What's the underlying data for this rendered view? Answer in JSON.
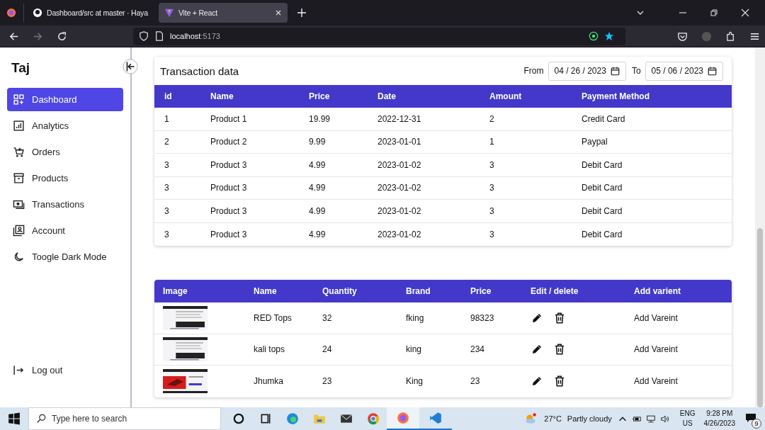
{
  "browser": {
    "tabs": [
      {
        "title": "Dashboard/src at master · Haya",
        "selected": false
      },
      {
        "title": "Vite + React",
        "selected": true
      }
    ],
    "address": {
      "host": "localhost",
      "port": ":5173"
    }
  },
  "sidebar": {
    "brand": "Taj",
    "items": [
      {
        "label": "Dashboard",
        "selected": true
      },
      {
        "label": "Analytics",
        "selected": false
      },
      {
        "label": "Orders",
        "selected": false
      },
      {
        "label": "Products",
        "selected": false
      },
      {
        "label": "Transactions",
        "selected": false
      },
      {
        "label": "Account",
        "selected": false
      },
      {
        "label": "Toogle Dark Mode",
        "selected": false
      }
    ],
    "logout": "Log out"
  },
  "transactions": {
    "title": "Transaction data",
    "from_label": "From",
    "from": "04 / 26 / 2023",
    "to_label": "To",
    "to": "05 / 06 / 2023",
    "columns": [
      "id",
      "Name",
      "Price",
      "Date",
      "Amount",
      "Payment Method"
    ],
    "rows": [
      [
        "1",
        "Product 1",
        "19.99",
        "2022-12-31",
        "2",
        "Credit Card"
      ],
      [
        "2",
        "Product 2",
        "9.99",
        "2023-01-01",
        "1",
        "Paypal"
      ],
      [
        "3",
        "Product 3",
        "4.99",
        "2023-01-02",
        "3",
        "Debit Card"
      ],
      [
        "3",
        "Product 3",
        "4.99",
        "2023-01-02",
        "3",
        "Debit Card"
      ],
      [
        "3",
        "Product 3",
        "4.99",
        "2023-01-02",
        "3",
        "Debit Card"
      ],
      [
        "3",
        "Product 3",
        "4.99",
        "2023-01-02",
        "3",
        "Debit Card"
      ]
    ]
  },
  "products": {
    "columns": [
      "Image",
      "Name",
      "Quantity",
      "Brand",
      "Price",
      "Edit / delete",
      "Add varient"
    ],
    "rows": [
      {
        "name": "RED Tops",
        "quantity": "32",
        "brand": "fking",
        "price": "98323",
        "action": "Add Vareint"
      },
      {
        "name": "kali tops",
        "quantity": "24",
        "brand": "king",
        "price": "234",
        "action": "Add Vareint"
      },
      {
        "name": "Jhumka",
        "quantity": "23",
        "brand": "King",
        "price": "23",
        "action": "Add Vareint"
      }
    ]
  },
  "taskbar": {
    "search_placeholder": "Type here to search",
    "temperature": "27°C",
    "weather": "Partly cloudy",
    "language": "ENG",
    "region": "US",
    "time": "9:28 PM",
    "date": "4/26/2023",
    "notifications": "9"
  }
}
